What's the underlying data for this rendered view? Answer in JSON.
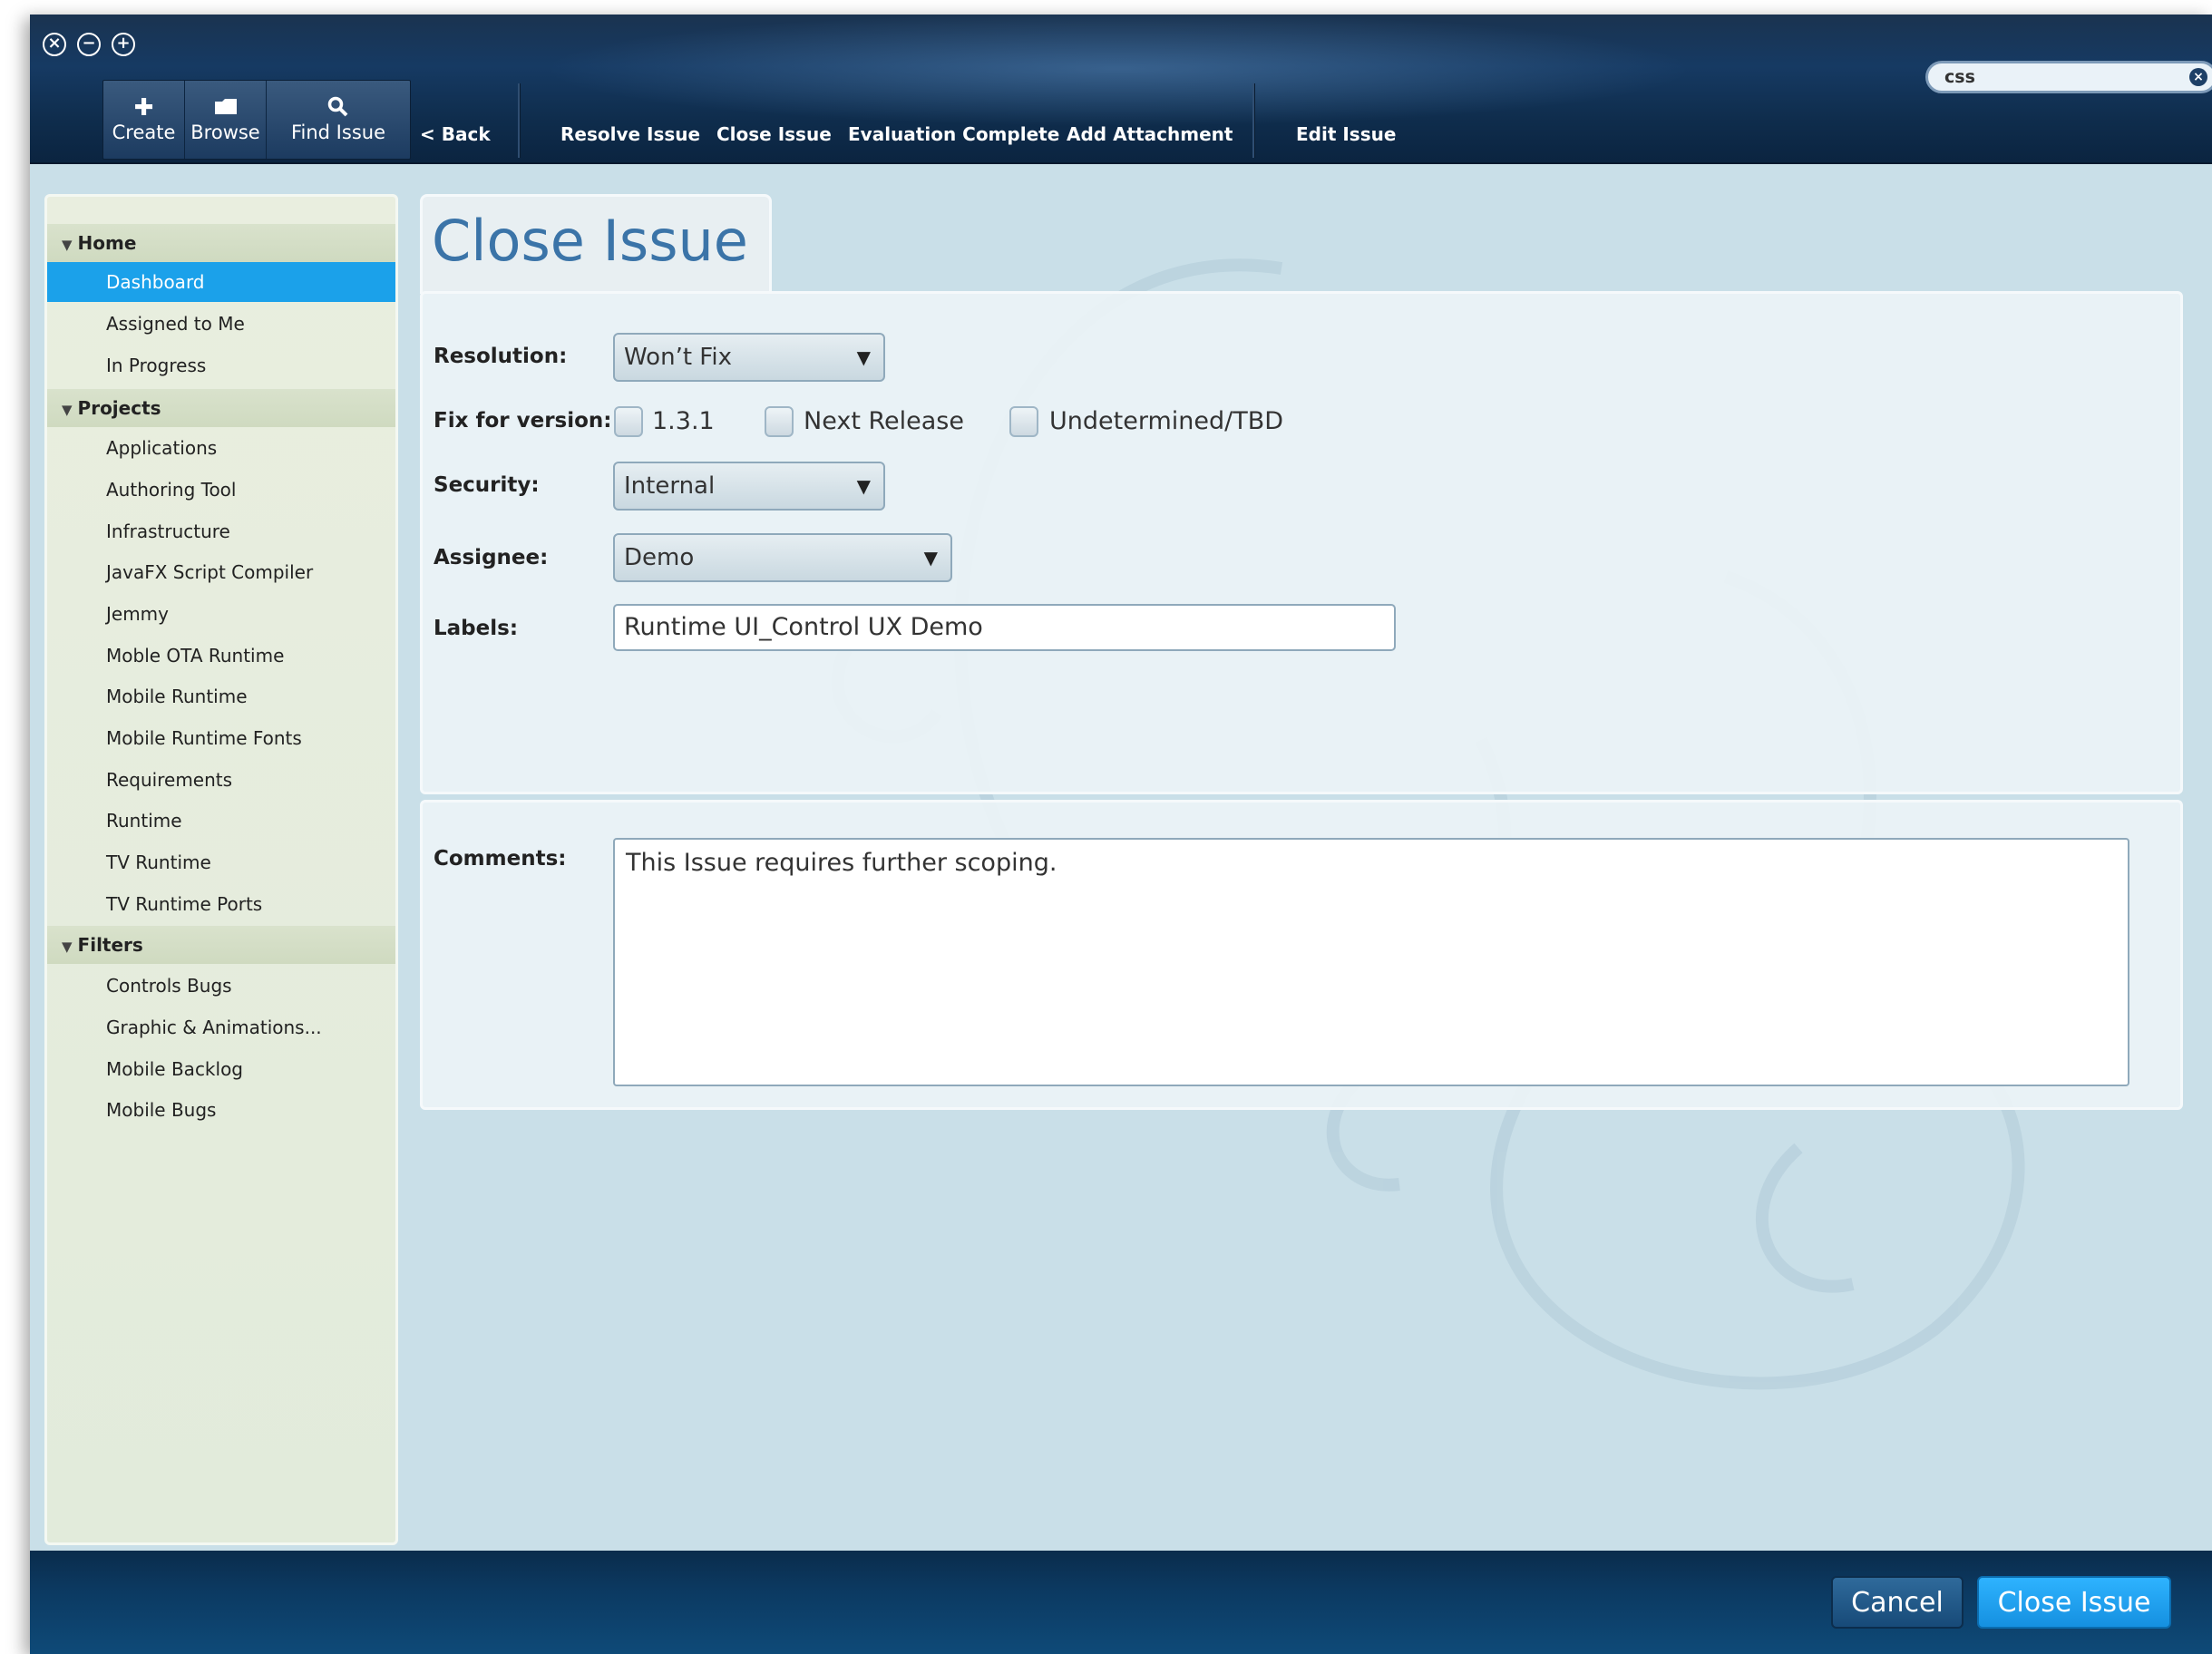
{
  "window_controls": [
    "close",
    "minimize",
    "maximize"
  ],
  "toolbar": {
    "create_label": "Create",
    "browse_label": "Browse",
    "find_label": "Find Issue",
    "back_label": "< Back",
    "actions": [
      "Resolve Issue",
      "Close Issue",
      "Evaluation Complete",
      "Add Attachment",
      "Edit Issue"
    ]
  },
  "search": {
    "value": "css"
  },
  "sidebar": {
    "home": {
      "label": "Home",
      "items": [
        "Dashboard",
        "Assigned to Me",
        "In Progress"
      ],
      "selected": "Dashboard"
    },
    "projects": {
      "label": "Projects",
      "items": [
        "Applications",
        "Authoring Tool",
        "Infrastructure",
        "JavaFX Script Compiler",
        "Jemmy",
        "Moble OTA Runtime",
        "Mobile Runtime",
        "Mobile Runtime Fonts",
        "Requirements",
        "Runtime",
        "TV Runtime",
        "TV Runtime Ports"
      ]
    },
    "filters": {
      "label": "Filters",
      "items": [
        "Controls Bugs",
        "Graphic & Animations...",
        "Mobile Backlog",
        "Mobile Bugs"
      ]
    }
  },
  "form": {
    "title": "Close Issue",
    "resolution": {
      "label": "Resolution:",
      "value": "Won’t Fix"
    },
    "fix_version": {
      "label": "Fix for version:",
      "options": [
        {
          "label": "1.3.1",
          "checked": false
        },
        {
          "label": "Next Release",
          "checked": false
        },
        {
          "label": "Undetermined/TBD",
          "checked": false
        }
      ]
    },
    "security": {
      "label": "Security:",
      "value": "Internal"
    },
    "assignee": {
      "label": "Assignee:",
      "value": "Demo"
    },
    "labels": {
      "label": "Labels:",
      "value": "Runtime UI_Control UX Demo"
    },
    "comments": {
      "label": "Comments:",
      "value": "This Issue requires further scoping."
    }
  },
  "footer": {
    "cancel_label": "Cancel",
    "close_label": "Close Issue"
  },
  "colors": {
    "accent": "#1ba1ea",
    "header_bg": "#163a63",
    "title_blue": "#3b74a8",
    "sidebar_bg": "#e2ebdb",
    "content_bg": "#c9dfe8"
  }
}
